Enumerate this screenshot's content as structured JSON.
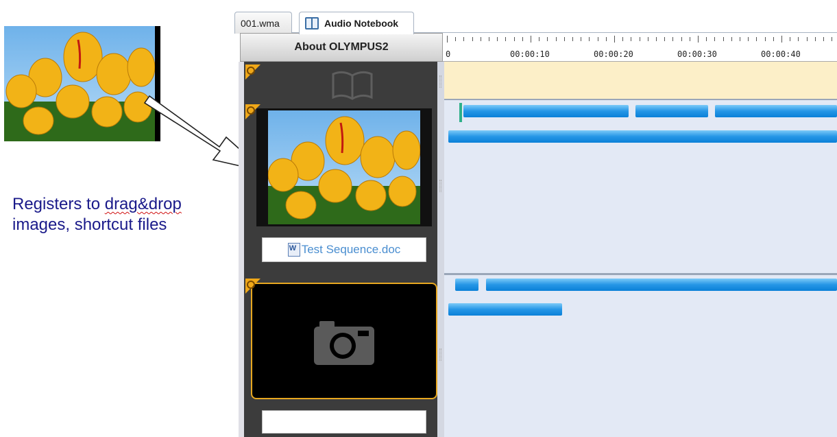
{
  "annotation": {
    "line1_a": "Registers to ",
    "line1_b": "drag&drop",
    "line2": "images, shortcut files"
  },
  "tabs": [
    {
      "label": "001.wma"
    },
    {
      "label": "Audio Notebook"
    }
  ],
  "column_header": "About OLYMPUS2",
  "ruler": {
    "labels": [
      "0",
      "00:00:10",
      "00:00:20",
      "00:00:30",
      "00:00:40"
    ]
  },
  "panel": {
    "doc_chip_label": "Test Sequence.doc",
    "empty_chip_label": ""
  },
  "icons": [
    "book-icon",
    "camera-icon",
    "word-document-icon",
    "bookmark-corner-icon"
  ],
  "colors": {
    "accent_orange": "#f0a818",
    "bar_blue": "#1a8fe3",
    "annotation_text": "#1a1a8a",
    "track_header": "#fcefc8",
    "timeline_bg": "#e3e9f5"
  }
}
